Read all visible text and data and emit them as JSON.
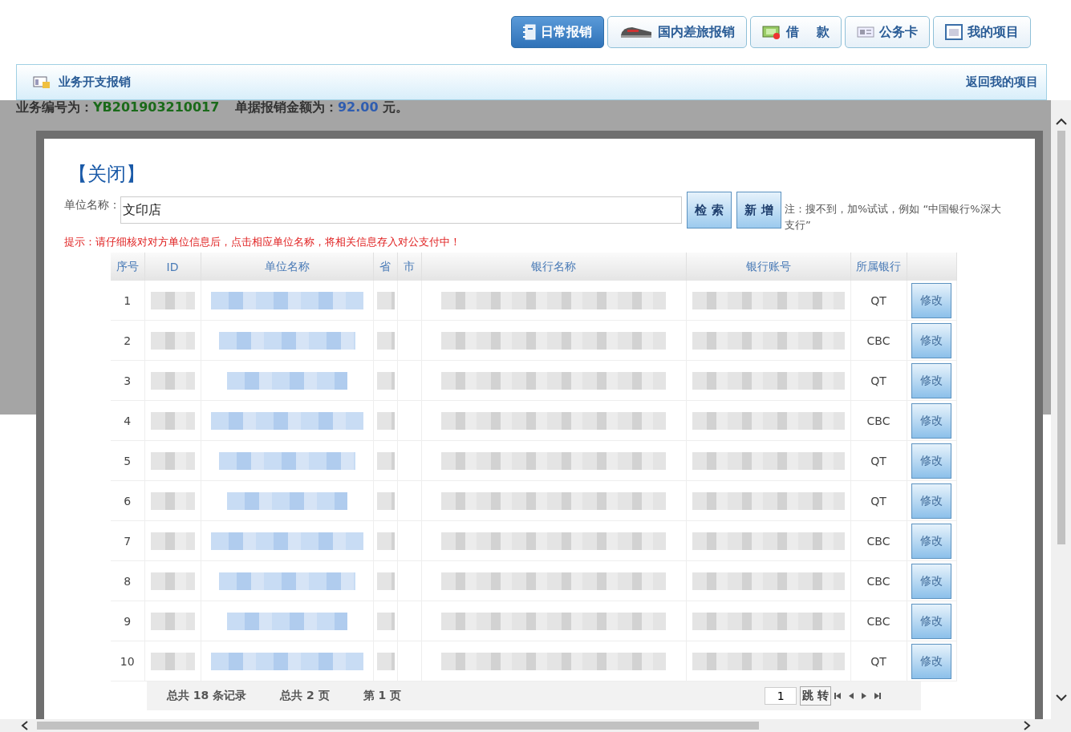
{
  "nav_tabs": [
    {
      "label": "日常报销",
      "selected": true
    },
    {
      "label": "国内差旅报销",
      "selected": false
    },
    {
      "label": "借　 款",
      "selected": false
    },
    {
      "label": "公务卡",
      "selected": false
    },
    {
      "label": "我的项目",
      "selected": false
    }
  ],
  "header": {
    "title": "业务开支报销",
    "link": "返回我的项目"
  },
  "info": {
    "no_label": "业务编号为：",
    "no": "YB201903210017",
    "amount_label": "单据报销金额为：",
    "amount": "92.00",
    "unit": "元。"
  },
  "dialog": {
    "close": "【关闭】",
    "search_label": "单位名称：",
    "search_value": "文印店",
    "buttons": [
      "检 索",
      "新 增"
    ],
    "note": "注：搜不到，加%试试，例如 “中国银行%深大支行”",
    "hint": "提示：请仔细核对对方单位信息后，点击相应单位名称，将相关信息存入对公支付中！",
    "table": {
      "columns": [
        "序号",
        "ID",
        "单位名称",
        "省",
        "市",
        "银行名称",
        "银行账号",
        "所属银行"
      ],
      "rows": [
        {
          "seq": "1",
          "bank": "QT",
          "action": "修改"
        },
        {
          "seq": "2",
          "bank": "CBC",
          "action": "修改"
        },
        {
          "seq": "3",
          "bank": "QT",
          "action": "修改"
        },
        {
          "seq": "4",
          "bank": "CBC",
          "action": "修改"
        },
        {
          "seq": "5",
          "bank": "QT",
          "action": "修改"
        },
        {
          "seq": "6",
          "bank": "QT",
          "action": "修改"
        },
        {
          "seq": "7",
          "bank": "CBC",
          "action": "修改"
        },
        {
          "seq": "8",
          "bank": "CBC",
          "action": "修改"
        },
        {
          "seq": "9",
          "bank": "CBC",
          "action": "修改"
        },
        {
          "seq": "10",
          "bank": "QT",
          "action": "修改"
        }
      ]
    },
    "pager": {
      "records": "总共 18 条记录",
      "pages": "总共 2 页",
      "current": "第 1 页",
      "page_input": "1",
      "go": "跳 转"
    }
  }
}
